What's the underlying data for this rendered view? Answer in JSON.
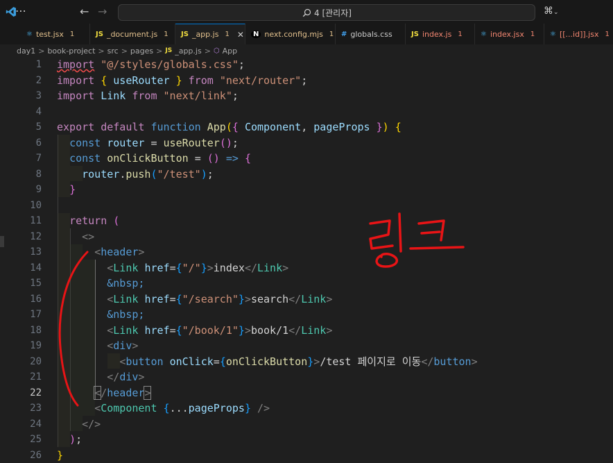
{
  "titlebar": {
    "menu_icon": "ellipsis-icon",
    "search_text": "4 [관리자]",
    "search_icon": "search-icon"
  },
  "tabs": [
    {
      "name": "test.jsx",
      "count": "1",
      "icon_text": "⚛",
      "icon_color": "#4fc1ff",
      "label_color": "#e2c08d",
      "count_color": "#e2c08d"
    },
    {
      "name": "_document.js",
      "count": "1",
      "icon_text": "JS",
      "icon_color": "#f1dd3f",
      "label_color": "#e2c08d",
      "count_color": "#e2c08d"
    },
    {
      "name": "_app.js",
      "count": "1",
      "icon_text": "JS",
      "icon_color": "#f1dd3f",
      "label_color": "#e2c08d",
      "count_color": "#e2c08d"
    },
    {
      "name": "next.config.mjs",
      "count": "1",
      "icon_text": "N",
      "icon_color": "#ffffff",
      "label_color": "#e2c08d",
      "count_color": "#e2c08d"
    },
    {
      "name": "globals.css",
      "count": "",
      "icon_text": "#",
      "icon_color": "#42a5f5",
      "label_color": "#cccccc",
      "count_color": "#cccccc"
    },
    {
      "name": "index.js",
      "count": "1",
      "icon_text": "JS",
      "icon_color": "#f1dd3f",
      "label_color": "#f48771",
      "count_color": "#f48771"
    },
    {
      "name": "index.jsx",
      "count": "1",
      "icon_text": "⚛",
      "icon_color": "#4fc1ff",
      "label_color": "#f48771",
      "count_color": "#f48771"
    },
    {
      "name": "[[...id]].jsx",
      "count": "1",
      "icon_text": "⚛",
      "icon_color": "#4fc1ff",
      "label_color": "#f48771",
      "count_color": "#f48771"
    }
  ],
  "breadcrumb": {
    "items": [
      "day1",
      "book-project",
      "src",
      "pages",
      "_app.js",
      "App"
    ],
    "separator": ">"
  },
  "editor": {
    "line_numbers": [
      "1",
      "2",
      "3",
      "4",
      "5",
      "6",
      "7",
      "8",
      "9",
      "10",
      "11",
      "12",
      "13",
      "14",
      "15",
      "16",
      "17",
      "18",
      "19",
      "20",
      "21",
      "22",
      "23",
      "24",
      "25",
      "26"
    ],
    "current_line": "22"
  },
  "annotation": {
    "handwritten_text": "링크",
    "color": "#e81416"
  }
}
